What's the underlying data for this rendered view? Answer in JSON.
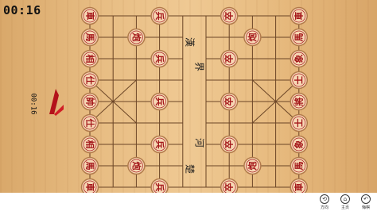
{
  "timer": "00:16",
  "side_timer": "00:16",
  "river": {
    "top_left": "楚",
    "top_right": "河",
    "bottom_left": "漢",
    "bottom_right": "界"
  },
  "colors": {
    "piece_text": "#a4161a",
    "piece_face": "#f6d7b4",
    "piece_ring": "#b27a4b",
    "line": "#6b4526"
  },
  "pieces": [
    {
      "file": 0,
      "rank": 0,
      "label": "車",
      "side": "left"
    },
    {
      "file": 1,
      "rank": 0,
      "label": "馬",
      "side": "left"
    },
    {
      "file": 2,
      "rank": 0,
      "label": "相",
      "side": "left"
    },
    {
      "file": 3,
      "rank": 0,
      "label": "仕",
      "side": "left"
    },
    {
      "file": 4,
      "rank": 0,
      "label": "帥",
      "side": "left"
    },
    {
      "file": 5,
      "rank": 0,
      "label": "仕",
      "side": "left"
    },
    {
      "file": 6,
      "rank": 0,
      "label": "相",
      "side": "left"
    },
    {
      "file": 7,
      "rank": 0,
      "label": "馬",
      "side": "left"
    },
    {
      "file": 8,
      "rank": 0,
      "label": "車",
      "side": "left"
    },
    {
      "file": 1,
      "rank": 2,
      "label": "炮",
      "side": "left"
    },
    {
      "file": 7,
      "rank": 2,
      "label": "炮",
      "side": "left"
    },
    {
      "file": 0,
      "rank": 3,
      "label": "兵",
      "side": "left"
    },
    {
      "file": 2,
      "rank": 3,
      "label": "兵",
      "side": "left"
    },
    {
      "file": 4,
      "rank": 3,
      "label": "兵",
      "side": "left"
    },
    {
      "file": 6,
      "rank": 3,
      "label": "兵",
      "side": "left"
    },
    {
      "file": 8,
      "rank": 3,
      "label": "兵",
      "side": "left"
    },
    {
      "file": 0,
      "rank": 6,
      "label": "卒",
      "side": "right"
    },
    {
      "file": 2,
      "rank": 6,
      "label": "卒",
      "side": "right"
    },
    {
      "file": 4,
      "rank": 6,
      "label": "卒",
      "side": "right"
    },
    {
      "file": 6,
      "rank": 6,
      "label": "卒",
      "side": "right"
    },
    {
      "file": 8,
      "rank": 6,
      "label": "卒",
      "side": "right"
    },
    {
      "file": 1,
      "rank": 7,
      "label": "炮",
      "side": "right"
    },
    {
      "file": 7,
      "rank": 7,
      "label": "炮",
      "side": "right"
    },
    {
      "file": 0,
      "rank": 9,
      "label": "車",
      "side": "right"
    },
    {
      "file": 1,
      "rank": 9,
      "label": "馬",
      "side": "right"
    },
    {
      "file": 2,
      "rank": 9,
      "label": "象",
      "side": "right"
    },
    {
      "file": 3,
      "rank": 9,
      "label": "士",
      "side": "right"
    },
    {
      "file": 4,
      "rank": 9,
      "label": "將",
      "side": "right"
    },
    {
      "file": 5,
      "rank": 9,
      "label": "士",
      "side": "right"
    },
    {
      "file": 6,
      "rank": 9,
      "label": "象",
      "side": "right"
    },
    {
      "file": 7,
      "rank": 9,
      "label": "馬",
      "side": "right"
    },
    {
      "file": 8,
      "rank": 9,
      "label": "車",
      "side": "right"
    }
  ],
  "toolbar": {
    "buttons": [
      {
        "name": "direction-button",
        "icon": "rotate-icon",
        "glyph": "⟲",
        "label": "方向"
      },
      {
        "name": "menu-button",
        "icon": "home-icon",
        "glyph": "⌂",
        "label": "主页"
      },
      {
        "name": "undo-button",
        "icon": "undo-icon",
        "glyph": "↶",
        "label": "悔棋"
      }
    ]
  }
}
